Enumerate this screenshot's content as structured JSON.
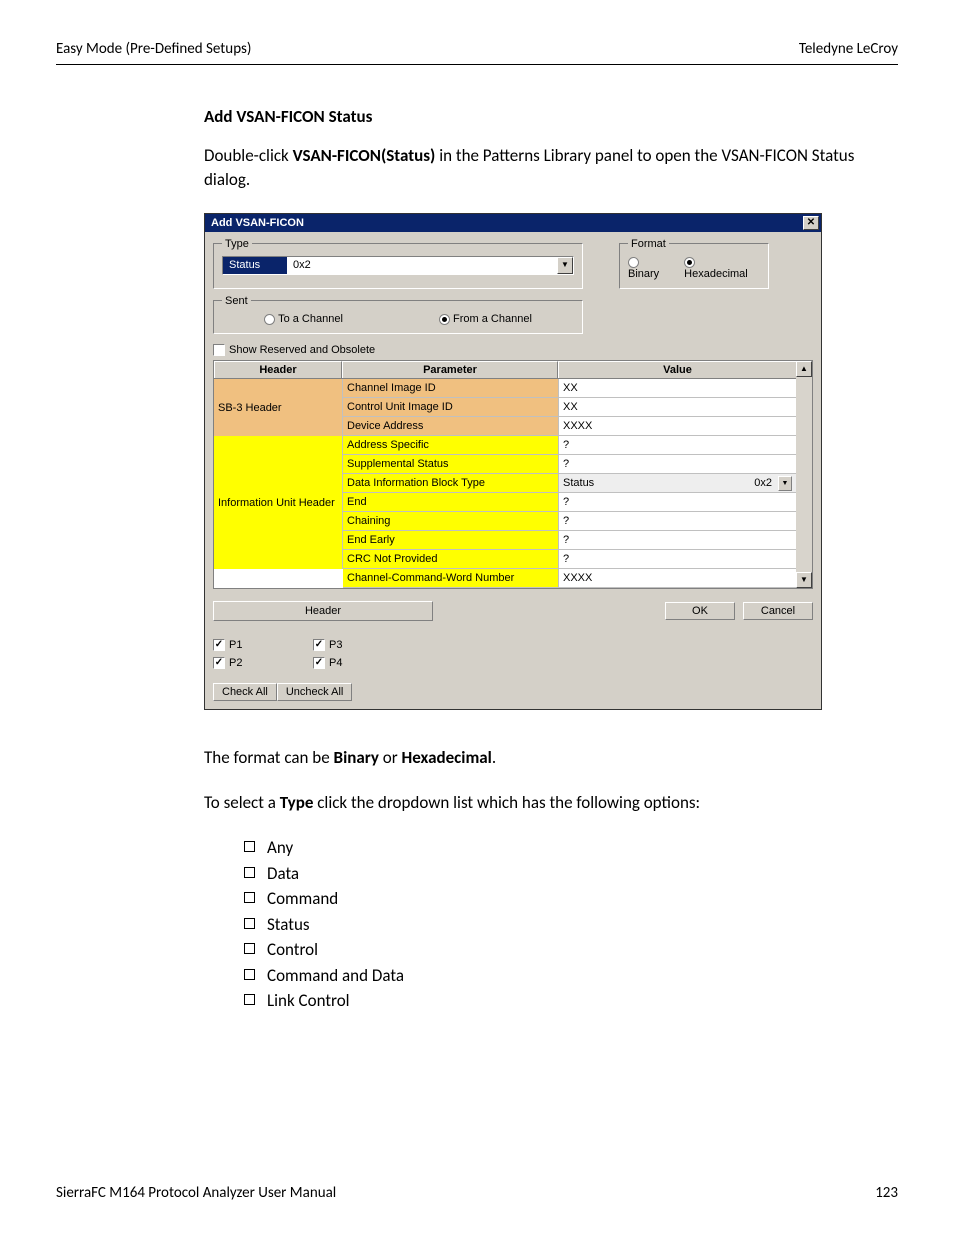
{
  "header": {
    "left": "Easy Mode (Pre-Defined Setups)",
    "right": "Teledyne LeCroy"
  },
  "section": {
    "title": "Add VSAN-FICON Status",
    "intro_pre": "Double-click ",
    "intro_bold": "VSAN-FICON(Status)",
    "intro_post": " in the Patterns Library panel to open the VSAN-FICON Status dialog.",
    "format_pre": "The format can be ",
    "format_b1": "Binary",
    "format_mid": " or ",
    "format_b2": "Hexadecimal",
    "format_post": ".",
    "type_pre": "To select a ",
    "type_bold": "Type",
    "type_post": " click the dropdown list which has the following options:"
  },
  "dialog": {
    "title": "Add VSAN-FICON",
    "type_group": "Type",
    "type_sel": "Status",
    "type_code": "0x2",
    "format_group": "Format",
    "format_binary": "Binary",
    "format_hex": "Hexadecimal",
    "sent_group": "Sent",
    "sent_to": "To a Channel",
    "sent_from": "From a Channel",
    "show_reserved": "Show Reserved and Obsolete",
    "grid": {
      "h_header": "Header",
      "h_param": "Parameter",
      "h_value": "Value",
      "sb3": "SB-3 Header",
      "iu": "Information Unit Header",
      "rows_sb3": [
        {
          "p": "Channel Image ID",
          "v": "XX"
        },
        {
          "p": "Control Unit Image ID",
          "v": "XX"
        },
        {
          "p": "Device Address",
          "v": "XXXX"
        }
      ],
      "rows_iu": [
        {
          "p": "Address Specific",
          "v": "?"
        },
        {
          "p": "Supplemental Status",
          "v": "?"
        },
        {
          "p": "Data Information Block Type",
          "v": "Status",
          "v2": "0x2"
        },
        {
          "p": "End",
          "v": "?"
        },
        {
          "p": "Chaining",
          "v": "?"
        },
        {
          "p": "End Early",
          "v": "?"
        },
        {
          "p": "CRC Not Provided",
          "v": "?"
        },
        {
          "p": "Channel-Command-Word Number",
          "v": "XXXX"
        }
      ]
    },
    "header_btn": "Header",
    "ok": "OK",
    "cancel": "Cancel",
    "ports": {
      "p1": "P1",
      "p2": "P2",
      "p3": "P3",
      "p4": "P4"
    },
    "check_all": "Check All",
    "uncheck_all": "Uncheck All"
  },
  "options": [
    "Any",
    "Data",
    "Command",
    "Status",
    "Control",
    "Command and Data",
    "Link Control"
  ],
  "footer": {
    "left": "SierraFC M164 Protocol Analyzer User Manual",
    "right": "123"
  }
}
